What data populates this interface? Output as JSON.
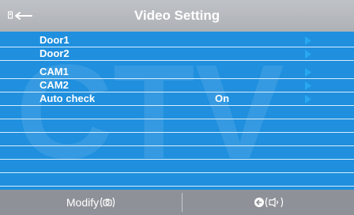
{
  "title": "Video Setting",
  "menu": {
    "items": [
      {
        "label": "Door1",
        "value": ""
      },
      {
        "label": "Door2",
        "value": ""
      },
      {
        "label": "CAM1",
        "value": ""
      },
      {
        "label": "CAM2",
        "value": ""
      },
      {
        "label": "Auto check",
        "value": "On"
      }
    ]
  },
  "watermark_text": "CTV",
  "footer": {
    "modify_label": "Modify",
    "back_icon": "back-icon"
  },
  "colors": {
    "menu_bg": "#1f8fde",
    "header_bg": "#b6b9bd",
    "footer_bg": "#8e9298",
    "arrow": "#29a8f0"
  }
}
